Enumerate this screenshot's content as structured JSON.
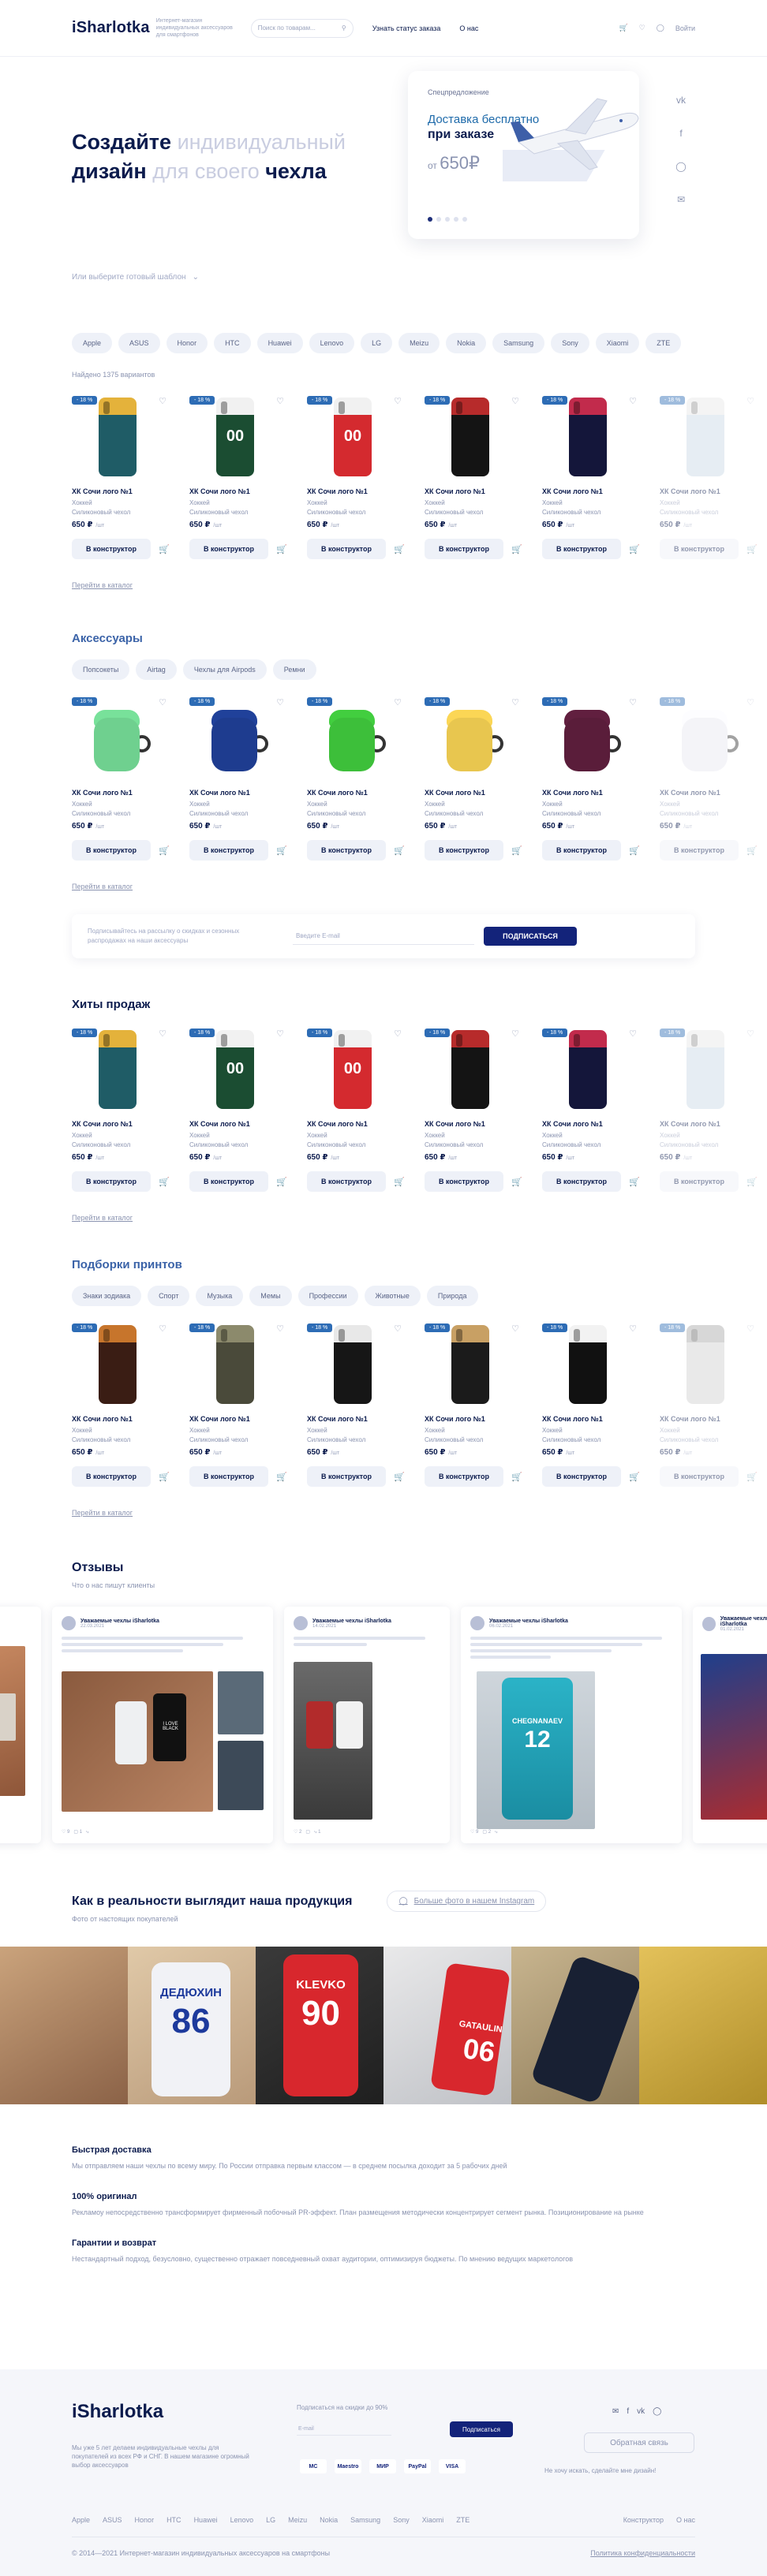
{
  "header": {
    "logo": "iSharlotka",
    "tagline": "Интернет-магазин индивидуальных аксессуаров для смартфонов",
    "search_placeholder": "Поиск по товарам...",
    "order_status": "Узнать статус заказа",
    "about": "О нас",
    "login": "Войти"
  },
  "hero": {
    "title_1": "Создайте",
    "title_1_light": " индивидуальный",
    "title_2": "дизайн",
    "title_2_light": " для своего ",
    "title_3": "чехла",
    "pick": "Или выберите готовый шаблон",
    "promo": {
      "kicker": "Спецпредложение",
      "line1": "Доставка бесплатно",
      "line2": "при заказе",
      "from": "от",
      "price": "650₽"
    }
  },
  "brands": [
    "Apple",
    "ASUS",
    "Honor",
    "HTC",
    "Huawei",
    "Lenovo",
    "LG",
    "Meizu",
    "Nokia",
    "Samsung",
    "Sony",
    "Xiaomi",
    "ZTE"
  ],
  "found": "Найдено 1375 вариантов",
  "products": {
    "name": "ХК Сочи лого №1",
    "sub1": "Хоккей",
    "sub2": "Силиконовый чехол",
    "price": "650 ₽",
    "price_note": "/шт",
    "badge": "- 18 %",
    "button": "В конструктор"
  },
  "more_link": "Перейти в каталог",
  "accessories": {
    "title": "Аксессуары",
    "chips": [
      "Попсокеты",
      "Airtag",
      "Чехлы для Airpods",
      "Ремни"
    ]
  },
  "newsletter": {
    "text": "Подписывайтесь на рассылку о скидках и сезонных распродажах на наши аксессуары",
    "placeholder": "Введите E-mail",
    "button": "ПОДПИСАТЬСЯ"
  },
  "hits": {
    "title": "Хиты продаж"
  },
  "prints": {
    "title": "Подборки принтов",
    "chips": [
      "Знаки зодиака",
      "Спорт",
      "Музыка",
      "Мемы",
      "Профессии",
      "Животные",
      "Природа"
    ]
  },
  "reviews": {
    "title": "Отзывы",
    "subtitle": "Что о нас пишут клиенты",
    "group": "Уважаемые чехлы iSharlotka",
    "case_texts": [
      "I LOVE BLACK",
      "CHEGNANAEV",
      "12"
    ]
  },
  "real": {
    "title": "Как в реальности выглядит наша продукция",
    "subtitle": "Фото от настоящих покупателей",
    "ig_link": "Больше фото в нашем Instagram",
    "photo_texts": [
      "ДЕДЮХИН",
      "86",
      "KLEVKO",
      "90",
      "GATAULIN",
      "06"
    ]
  },
  "info": [
    {
      "title": "Быстрая доставка",
      "text": "Мы отправляем наши чехлы по всему миру. По России отправка первым классом — в среднем посылка доходит за 5 рабочих дней"
    },
    {
      "title": "100% оригинал",
      "text": "Рекламоу непосредственно трансформирует фирменный побочный PR-эффект. План размещения методически концентрирует сегмент рынка. Позиционирование на рынке"
    },
    {
      "title": "Гарантии и возврат",
      "text": "Нестандартный подход, безусловно, существенно отражает повседневный охват аудитории, оптимизируя бюджеты. По мнению ведущих маркетологов"
    }
  ],
  "footer": {
    "logo": "iSharlotka",
    "desc": "Мы уже 5 лет делаем индивидуальные чехлы для покупателей из всех РФ и СНГ. В нашем магазине огромный выбор аксессуаров",
    "subscribe": "Подписаться на скидки до 90%",
    "email_placeholder": "E-mail",
    "subscribe_btn": "Подписаться",
    "pays": [
      "MC",
      "Maestro",
      "МИР",
      "PayPal",
      "VISA"
    ],
    "feedback": "Обратная связь",
    "note": "Не хочу искать, сделайте мне дизайн!",
    "brands": [
      "Apple",
      "ASUS",
      "Honor",
      "HTC",
      "Huawei",
      "Lenovo",
      "LG",
      "Meizu",
      "Nokia",
      "Samsung",
      "Sony",
      "Xiaomi",
      "ZTE"
    ],
    "right_links": [
      "Конструктор",
      "О нас"
    ],
    "copyright": "© 2014—2021 Интернет-магазин индивидуальных аксессуаров на смартфоны",
    "privacy": "Политика конфиденциальности"
  },
  "colors": {
    "brand": "#0b1b4d",
    "accent": "#13237a",
    "badge": "#2d6cb5",
    "muted": "#8a93b0"
  }
}
